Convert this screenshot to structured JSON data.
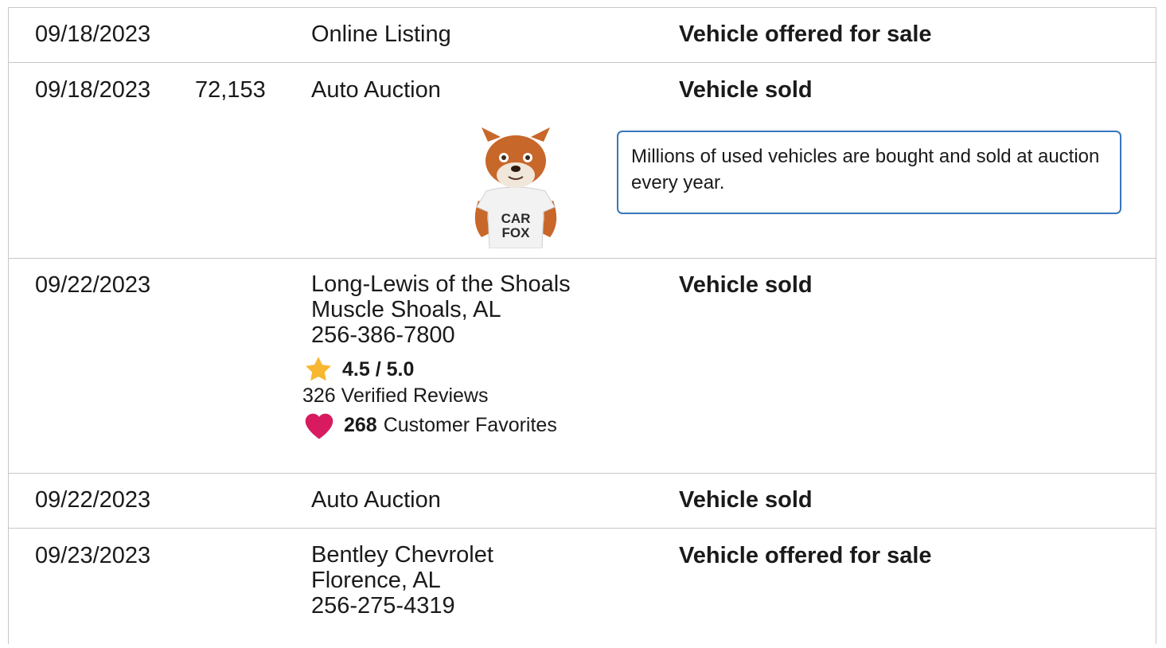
{
  "rows": [
    {
      "date": "09/18/2023",
      "odometer": "",
      "source": [
        "Online Listing"
      ],
      "event": "Vehicle offered for sale"
    },
    {
      "date": "09/18/2023",
      "odometer": "72,153",
      "source": [
        "Auto Auction"
      ],
      "event": "Vehicle sold",
      "tip": "Millions of used vehicles are bought and sold at auction every year.",
      "mascot": "CARFAX fox mascot"
    },
    {
      "date": "09/22/2023",
      "odometer": "",
      "source": [
        "Long-Lewis of the Shoals",
        "Muscle Shoals, AL",
        "256-386-7800"
      ],
      "event": "Vehicle sold",
      "rating": {
        "score": "4.5 / 5.0",
        "reviews": "326 Verified Reviews",
        "favorites_count": "268",
        "favorites_label": "Customer Favorites",
        "star_color": "#f7b731",
        "heart_color": "#d81b60"
      }
    },
    {
      "date": "09/22/2023",
      "odometer": "",
      "source": [
        "Auto Auction"
      ],
      "event": "Vehicle sold"
    },
    {
      "date": "09/23/2023",
      "odometer": "",
      "source": [
        "Bentley Chevrolet",
        "Florence, AL",
        "256-275-4319"
      ],
      "event": "Vehicle offered for sale"
    }
  ],
  "mascot_shirt": [
    "CAR",
    "FOX"
  ],
  "colors": {
    "border": "#c8c8c8",
    "tip_border": "#3777bc"
  }
}
